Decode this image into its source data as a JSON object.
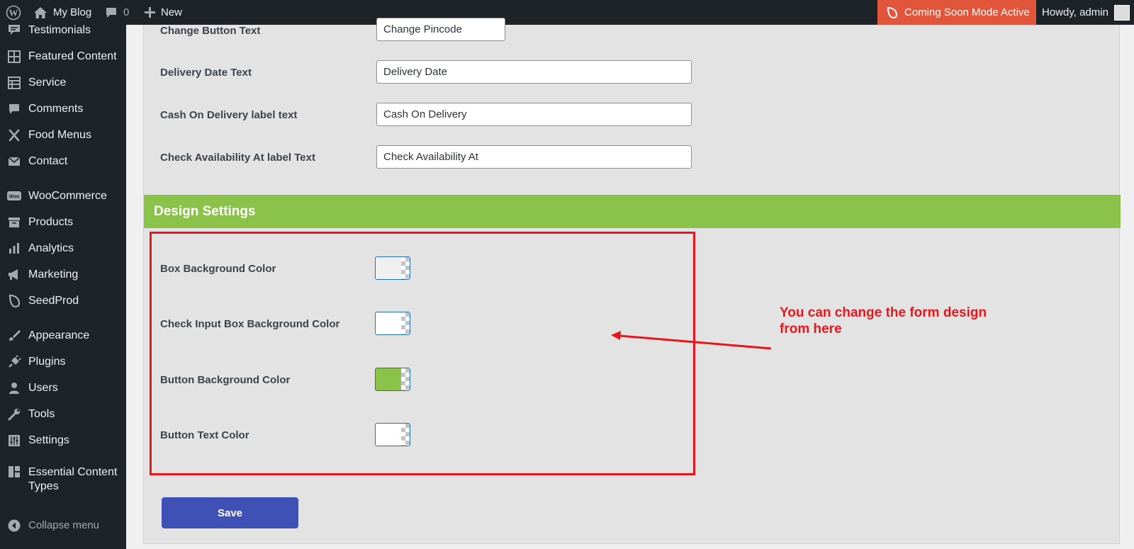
{
  "adminbar": {
    "site_name": "My Blog",
    "comments_count": "0",
    "new_label": "New",
    "coming_soon": "Coming Soon Mode Active",
    "howdy": "Howdy, admin"
  },
  "sidebar": {
    "items": [
      {
        "label": "Testimonials",
        "icon": "testimonial-icon"
      },
      {
        "label": "Featured Content",
        "icon": "grid-icon"
      },
      {
        "label": "Service",
        "icon": "table-icon"
      },
      {
        "label": "Comments",
        "icon": "comment-icon"
      },
      {
        "label": "Food Menus",
        "icon": "cutlery-icon"
      },
      {
        "label": "Contact",
        "icon": "envelope-icon"
      },
      {
        "label": "WooCommerce",
        "icon": "woo-icon"
      },
      {
        "label": "Products",
        "icon": "archive-icon"
      },
      {
        "label": "Analytics",
        "icon": "bar-chart-icon"
      },
      {
        "label": "Marketing",
        "icon": "megaphone-icon"
      },
      {
        "label": "SeedProd",
        "icon": "leaf-icon"
      },
      {
        "label": "Appearance",
        "icon": "brush-icon"
      },
      {
        "label": "Plugins",
        "icon": "plug-icon"
      },
      {
        "label": "Users",
        "icon": "user-icon"
      },
      {
        "label": "Tools",
        "icon": "wrench-icon"
      },
      {
        "label": "Settings",
        "icon": "sliders-icon"
      },
      {
        "label": "Essential Content Types",
        "icon": "layout-icon"
      }
    ],
    "collapse_label": "Collapse menu"
  },
  "form": {
    "fields": [
      {
        "label": "Change Button Text",
        "value": "Change Pincode"
      },
      {
        "label": "Delivery Date Text",
        "value": "Delivery Date"
      },
      {
        "label": "Cash On Delivery label text",
        "value": "Cash On Delivery"
      },
      {
        "label": "Check Availability At label Text",
        "value": "Check Availability At"
      }
    ],
    "design_header": "Design Settings",
    "colors": [
      {
        "label": "Box Background Color",
        "color": "#f0f0f0"
      },
      {
        "label": "Check Input Box Background Color",
        "color": "#ffffff"
      },
      {
        "label": "Button Background Color",
        "color": "#8bc34a"
      },
      {
        "label": "Button Text Color",
        "color": "#ffffff"
      }
    ],
    "save_label": "Save"
  },
  "annotation": {
    "line1": "You can change the form design",
    "line2": "from here"
  },
  "colors": {
    "adminbar": "#1d2327",
    "accent_green": "#8bc34a",
    "save_button": "#3f51b5",
    "annotation_red": "#e8161c",
    "coming_soon": "#e1563b"
  }
}
